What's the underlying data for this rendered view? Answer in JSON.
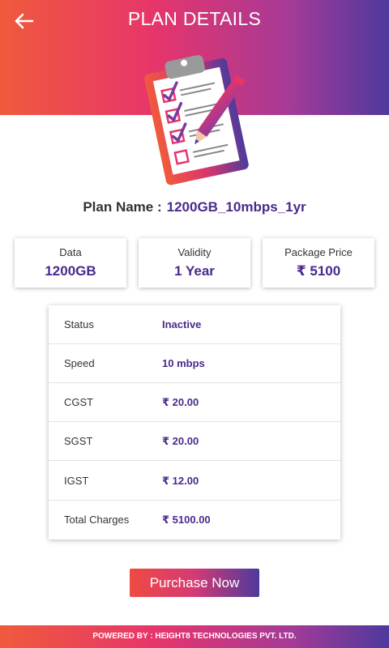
{
  "header": {
    "title": "PLAN DETAILS",
    "back_icon": "arrow-left-icon"
  },
  "illustration": {
    "icon": "clipboard-checklist-icon"
  },
  "plan": {
    "label": "Plan Name :",
    "name": "1200GB_10mbps_1yr"
  },
  "summary": [
    {
      "label": "Data",
      "value": "1200GB"
    },
    {
      "label": "Validity",
      "value": "1 Year"
    },
    {
      "label": "Package Price",
      "value": "₹ 5100"
    }
  ],
  "details": [
    {
      "label": "Status",
      "value": "Inactive"
    },
    {
      "label": "Speed",
      "value": "10 mbps"
    },
    {
      "label": "CGST",
      "value": "₹ 20.00"
    },
    {
      "label": "SGST",
      "value": "₹ 20.00"
    },
    {
      "label": "IGST",
      "value": "₹ 12.00"
    },
    {
      "label": "Total Charges",
      "value": "₹ 5100.00"
    }
  ],
  "actions": {
    "purchase_label": "Purchase Now"
  },
  "footer": {
    "text": "POWERED BY : HEIGHT8 TECHNOLOGIES PVT. LTD."
  },
  "colors": {
    "accent": "#4a2a8c",
    "gradient_start": "#f05a3c",
    "gradient_end": "#4d3a9c"
  }
}
